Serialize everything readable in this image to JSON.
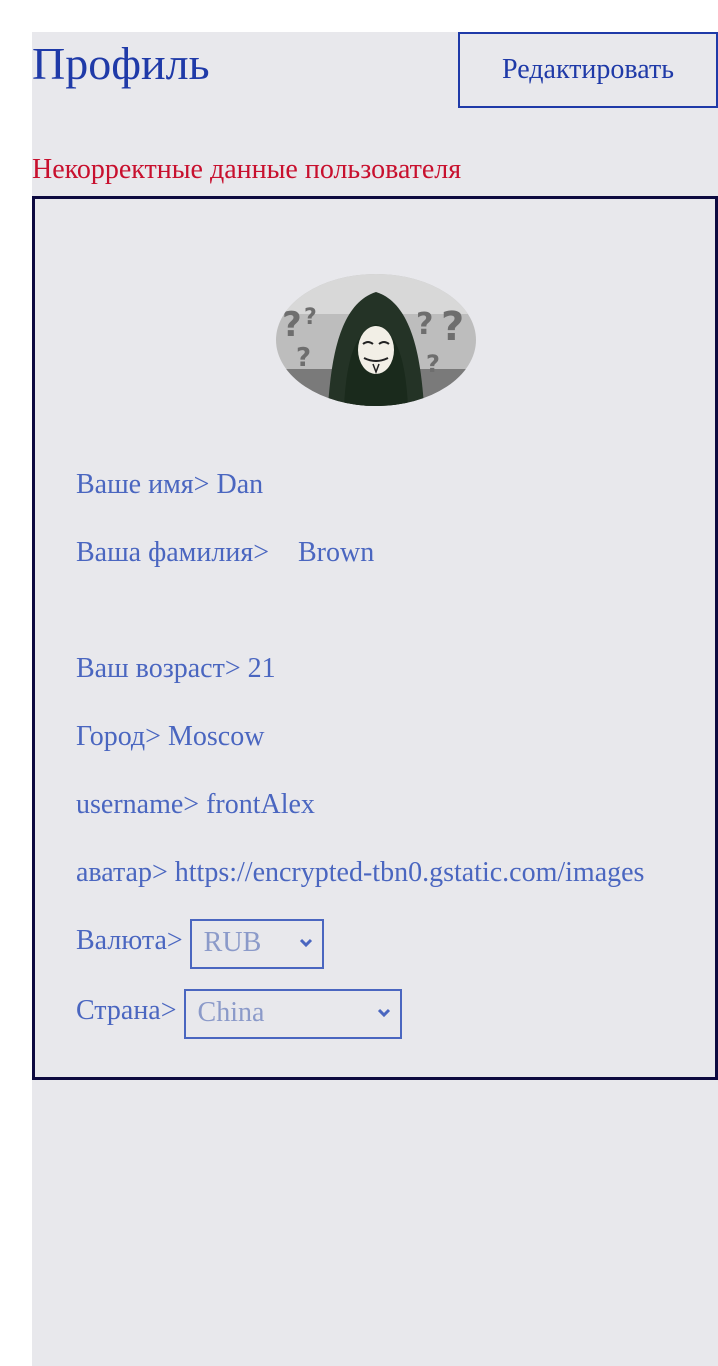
{
  "header": {
    "title": "Профиль",
    "edit_label": "Редактировать"
  },
  "error_text": "Некорректные данные пользователя",
  "profile": {
    "first_name_label": "Ваше имя>",
    "first_name": "Dan",
    "last_name_label": "Ваша фамилия>",
    "last_name": "Brown",
    "age_label": "Ваш возраст>",
    "age": "21",
    "city_label": "Город>",
    "city": "Moscow",
    "username_label": "username>",
    "username": "frontAlex",
    "avatar_label": "аватар>",
    "avatar_url": "https://encrypted-tbn0.gstatic.com/images",
    "currency_label": "Валюта>",
    "currency": "RUB",
    "country_label": "Страна>",
    "country": "China"
  },
  "colors": {
    "title": "#1f3aa8",
    "error": "#c8102e",
    "field_text": "#4a66c0",
    "card_border": "#0d0a40",
    "background": "#e8e8ec"
  }
}
